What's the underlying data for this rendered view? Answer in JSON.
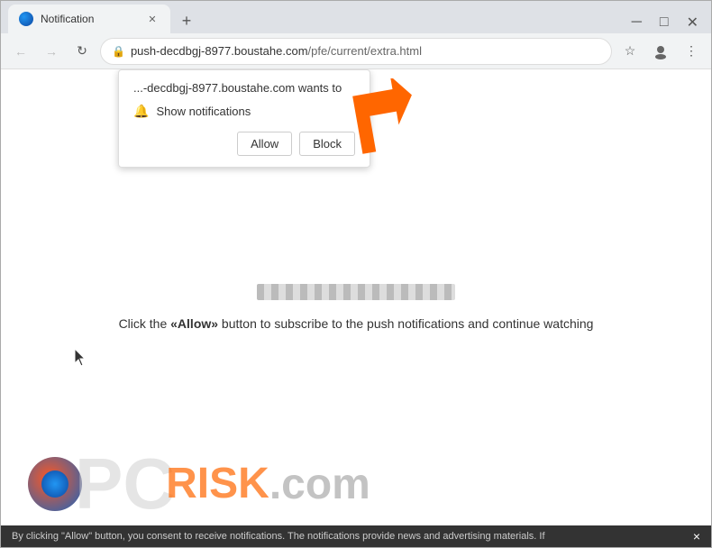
{
  "browser": {
    "tab_title": "Notification",
    "url_base": "push-decdbgj-8977.boustahe.com",
    "url_path": "/pfe/current/extra.html",
    "url_full": "push-decdbgj-8977.boustahe.com/pfe/current/extra.html"
  },
  "notification_popup": {
    "domain_text": "...-decdbgj-8977.boustahe.com wants to",
    "show_notifications": "Show notifications",
    "allow_button": "Allow",
    "block_button": "Block"
  },
  "page": {
    "instruction_text": "Click the «Allow» button to subscribe to the push notifications and continue watching"
  },
  "bottom_bar": {
    "text": "By clicking \"Allow\" button, you consent to receive notifications. The notifications provide news and advertising materials. If",
    "close_label": "×"
  },
  "window_controls": {
    "minimize": "─",
    "maximize": "□",
    "close": "✕"
  },
  "nav": {
    "back": "←",
    "forward": "→",
    "reload": "↻"
  }
}
